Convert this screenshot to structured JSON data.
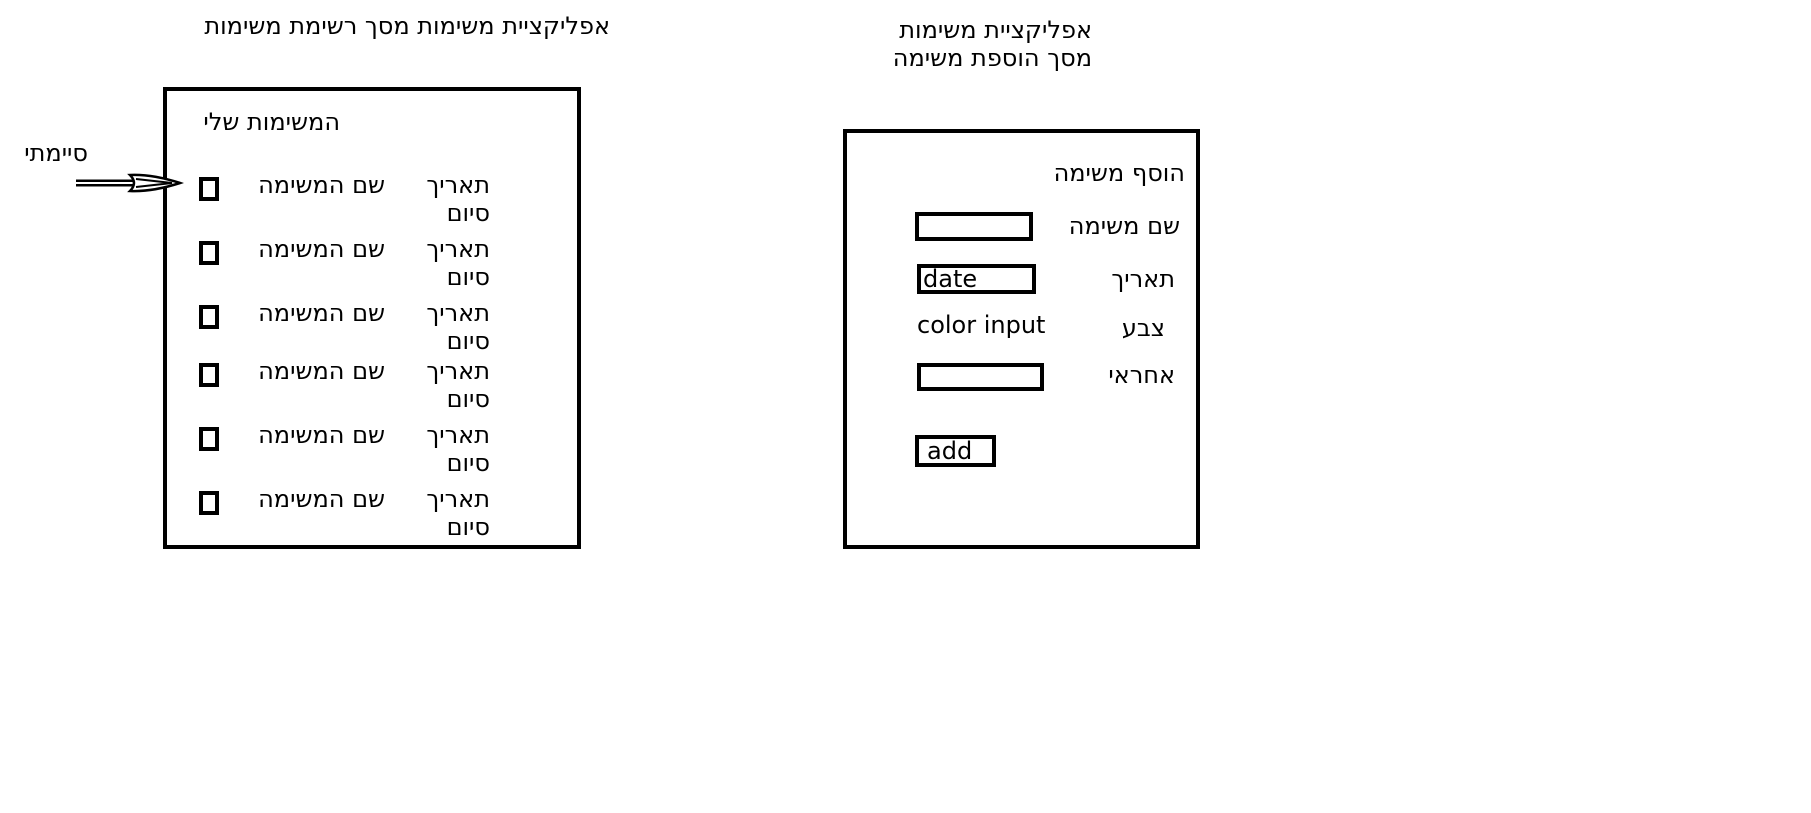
{
  "list_screen": {
    "caption": "אפליקציית משימות מסך רשימת משימות",
    "title": "המשימות שלי",
    "annotation": "סיימתי",
    "rows": [
      {
        "name": "שם המשימה",
        "date": "תאריך סיום"
      },
      {
        "name": "שם המשימה",
        "date": "תאריך סיום"
      },
      {
        "name": "שם המשימה",
        "date": "תאריך סיום"
      },
      {
        "name": "שם המשימה",
        "date": "תאריך סיום"
      },
      {
        "name": "שם המשימה",
        "date": "תאריך סיום"
      },
      {
        "name": "שם המשימה",
        "date": "תאריך סיום"
      }
    ]
  },
  "form_screen": {
    "caption_line1": "אפליקציית משימות",
    "caption_line2": "מסך הוספת משימה",
    "title": "הוסף משימה",
    "fields": {
      "name_label": "שם משימה",
      "date_label": "תאריך",
      "date_value": "date input",
      "color_label": "צבע",
      "color_value": "color input",
      "owner_label": "אחראי"
    },
    "add_label": "add"
  }
}
